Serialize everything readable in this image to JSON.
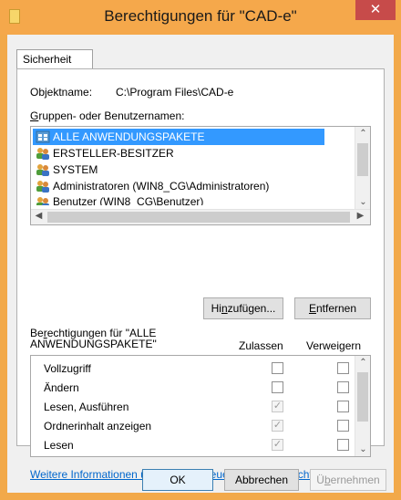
{
  "window": {
    "title": "Berechtigungen für \"CAD-e\"",
    "close_glyph": "✕"
  },
  "tab": {
    "label": "Sicherheit"
  },
  "object": {
    "label": "Objektname:",
    "value": "C:\\Program Files\\CAD-e"
  },
  "groups": {
    "label_prefix": "G",
    "label_rest": "ruppen- oder Benutzernamen:",
    "items": [
      {
        "label": "ALLE ANWENDUNGSPAKETE",
        "icon": "app-packages-icon",
        "selected": true
      },
      {
        "label": "ERSTELLER-BESITZER",
        "icon": "users-icon",
        "selected": false
      },
      {
        "label": "SYSTEM",
        "icon": "users-icon",
        "selected": false
      },
      {
        "label": "Administratoren (WIN8_CG\\Administratoren)",
        "icon": "users-icon",
        "selected": false
      },
      {
        "label": "Benutzer (WIN8_CG\\Benutzer)",
        "icon": "users-icon",
        "selected": false
      }
    ]
  },
  "buttons": {
    "add_pre": "Hi",
    "add_u": "n",
    "add_post": "zufügen...",
    "remove_u": "E",
    "remove_post": "ntfernen",
    "ok": "OK",
    "cancel": "Abbrechen",
    "apply_pre": "Ü",
    "apply_u": "b",
    "apply_post": "ernehmen"
  },
  "permissions": {
    "header_line1_pre": "Be",
    "header_line1_u": "r",
    "header_line1_post": "echtigungen für \"ALLE",
    "header_line2": "ANWENDUNGSPAKETE\"",
    "allow_label": "Zulassen",
    "deny_label": "Verweigern",
    "rows": [
      {
        "name": "Vollzugriff",
        "allow": false,
        "deny": false
      },
      {
        "name": "Ändern",
        "allow": false,
        "deny": false
      },
      {
        "name": "Lesen, Ausführen",
        "allow": true,
        "deny": false
      },
      {
        "name": "Ordnerinhalt anzeigen",
        "allow": true,
        "deny": false
      },
      {
        "name": "Lesen",
        "allow": true,
        "deny": false
      }
    ]
  },
  "link": {
    "text": "Weitere Informationen über Zugriffssteuerung und Berechtigungen"
  },
  "colors": {
    "titlebar": "#f5a84b",
    "close": "#c74b4a",
    "selection": "#3399ff",
    "link": "#0066cc"
  }
}
